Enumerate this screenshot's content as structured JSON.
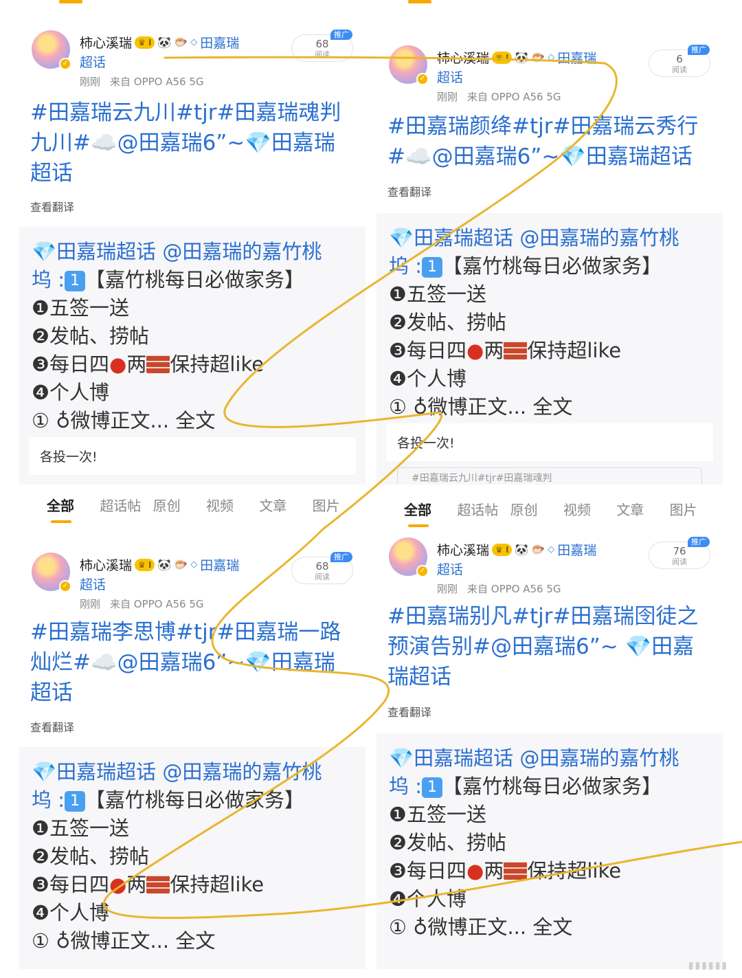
{
  "author": {
    "name": "柿心溪瑞",
    "level_badge": "I",
    "topic": "田嘉瑞",
    "topic_suffix": "超话",
    "time": "刚刚",
    "source": "来自 OPPO A56 5G",
    "promo": "推广",
    "read_label": "阅读"
  },
  "posts": [
    {
      "reads": "68",
      "text": "#田嘉瑞云九川#tjr#田嘉瑞魂判九川#☁️@田嘉瑞6”~💎田嘉瑞超话"
    },
    {
      "reads": "6",
      "text": "#田嘉瑞颜绛#tjr#田嘉瑞云秀行#☁️@田嘉瑞6”~💎田嘉瑞超话"
    },
    {
      "reads": "68",
      "text": "#田嘉瑞李思博#tjr#田嘉瑞一路灿烂#☁️@田嘉瑞6”~💎田嘉瑞超话"
    },
    {
      "reads": "76",
      "text": "#田嘉瑞别凡#tjr#田嘉瑞囹徒之预演告别#@田嘉瑞6”~ 💎田嘉瑞超话"
    }
  ],
  "translate": "查看翻译",
  "quote": {
    "topic": "💎田嘉瑞超话",
    "mention": "@田嘉瑞的嘉竹桃",
    "line2_prefix": "坞 :",
    "num": "1",
    "title": "【嘉竹桃每日必做家务】",
    "task1": "❶五签一送",
    "task2": "❷发帖、捞帖",
    "task3_a": "❸每日四",
    "task3_b": "两",
    "task3_c": "保持超like",
    "task4": "❹个人博",
    "more": "① ♁微博正文... 全文"
  },
  "note": "各投一次!",
  "mini_box": "#田嘉瑞云九川#tjr#田嘉瑞魂判",
  "tabs": [
    "全部",
    "超话帖",
    "原创",
    "视频",
    "文章",
    "图片"
  ],
  "colors": {
    "accent": "#f7a900",
    "link": "#2a6fd0",
    "badge": "#3d8cf4"
  }
}
